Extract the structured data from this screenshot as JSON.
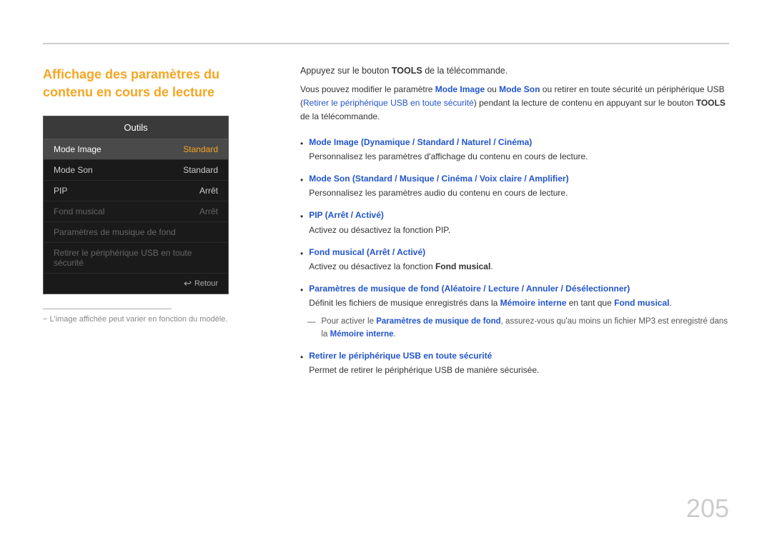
{
  "page": {
    "number": "205"
  },
  "top_line": {},
  "left": {
    "title": "Affichage des paramètres du contenu en cours de lecture",
    "outils": {
      "header": "Outils",
      "rows": [
        {
          "label": "Mode Image",
          "value": "Standard",
          "selected": true,
          "disabled": false
        },
        {
          "label": "Mode Son",
          "value": "Standard",
          "selected": false,
          "disabled": false
        },
        {
          "label": "PIP",
          "value": "Arrêt",
          "selected": false,
          "disabled": false
        },
        {
          "label": "Fond musical",
          "value": "Arrêt",
          "selected": false,
          "disabled": true
        },
        {
          "label": "Paramètres de musique de fond",
          "value": "",
          "selected": false,
          "disabled": true
        },
        {
          "label": "Retirer le périphérique USB en toute sécurité",
          "value": "",
          "selected": false,
          "disabled": true
        }
      ],
      "footer": "Retour"
    },
    "footnote_divider": true,
    "footnote": "−  L'image affichée peut varier en fonction du modèle."
  },
  "right": {
    "intro_line": "Appuyez sur le bouton TOOLS de la télécommande.",
    "intro_bold_tools": "TOOLS",
    "intro_para": "Vous pouvez modifier le paramètre Mode Image ou Mode Son ou retirer en toute sécurité un périphérique USB (Retirer le périphérique USB en toute sécurité) pendant la lecture de contenu en appuyant sur le bouton TOOLS de la télécommande.",
    "bullets": [
      {
        "title": "Mode Image (Dynamique / Standard / Naturel / Cinéma)",
        "sub": "Personnalisez les paramètres d'affichage du contenu en cours de lecture."
      },
      {
        "title": "Mode Son (Standard / Musique / Cinéma / Voix claire / Amplifier)",
        "sub": "Personnalisez les paramètres audio du contenu en cours de lecture."
      },
      {
        "title": "PIP (Arrêt / Activé)",
        "sub": "Activez ou désactivez la fonction PIP."
      },
      {
        "title": "Fond musical (Arrêt / Activé)",
        "sub_bold_start": "Activez ou désactivez la fonction ",
        "sub_bold": "Fond musical",
        "sub_end": "."
      },
      {
        "title": "Paramètres de musique de fond (Aléatoire / Lecture / Annuler / Désélectionner)",
        "sub_prefix": "Définit les fichiers de musique enregistrés dans la ",
        "sub_bold1": "Mémoire interne",
        "sub_mid": " en tant que ",
        "sub_bold2": "Fond musical",
        "sub_suffix": "."
      },
      {
        "note": true,
        "note_text_start": "Pour activer le ",
        "note_bold": "Paramètres de musique de fond",
        "note_text_mid": ", assurez-vous qu'au moins un fichier MP3 est enregistré dans la ",
        "note_bold2": "Mémoire interne",
        "note_text_end": "."
      },
      {
        "title": "Retirer le périphérique USB en toute sécurité",
        "sub": "Permet de retirer le périphérique USB de manière sécurisée."
      }
    ]
  }
}
